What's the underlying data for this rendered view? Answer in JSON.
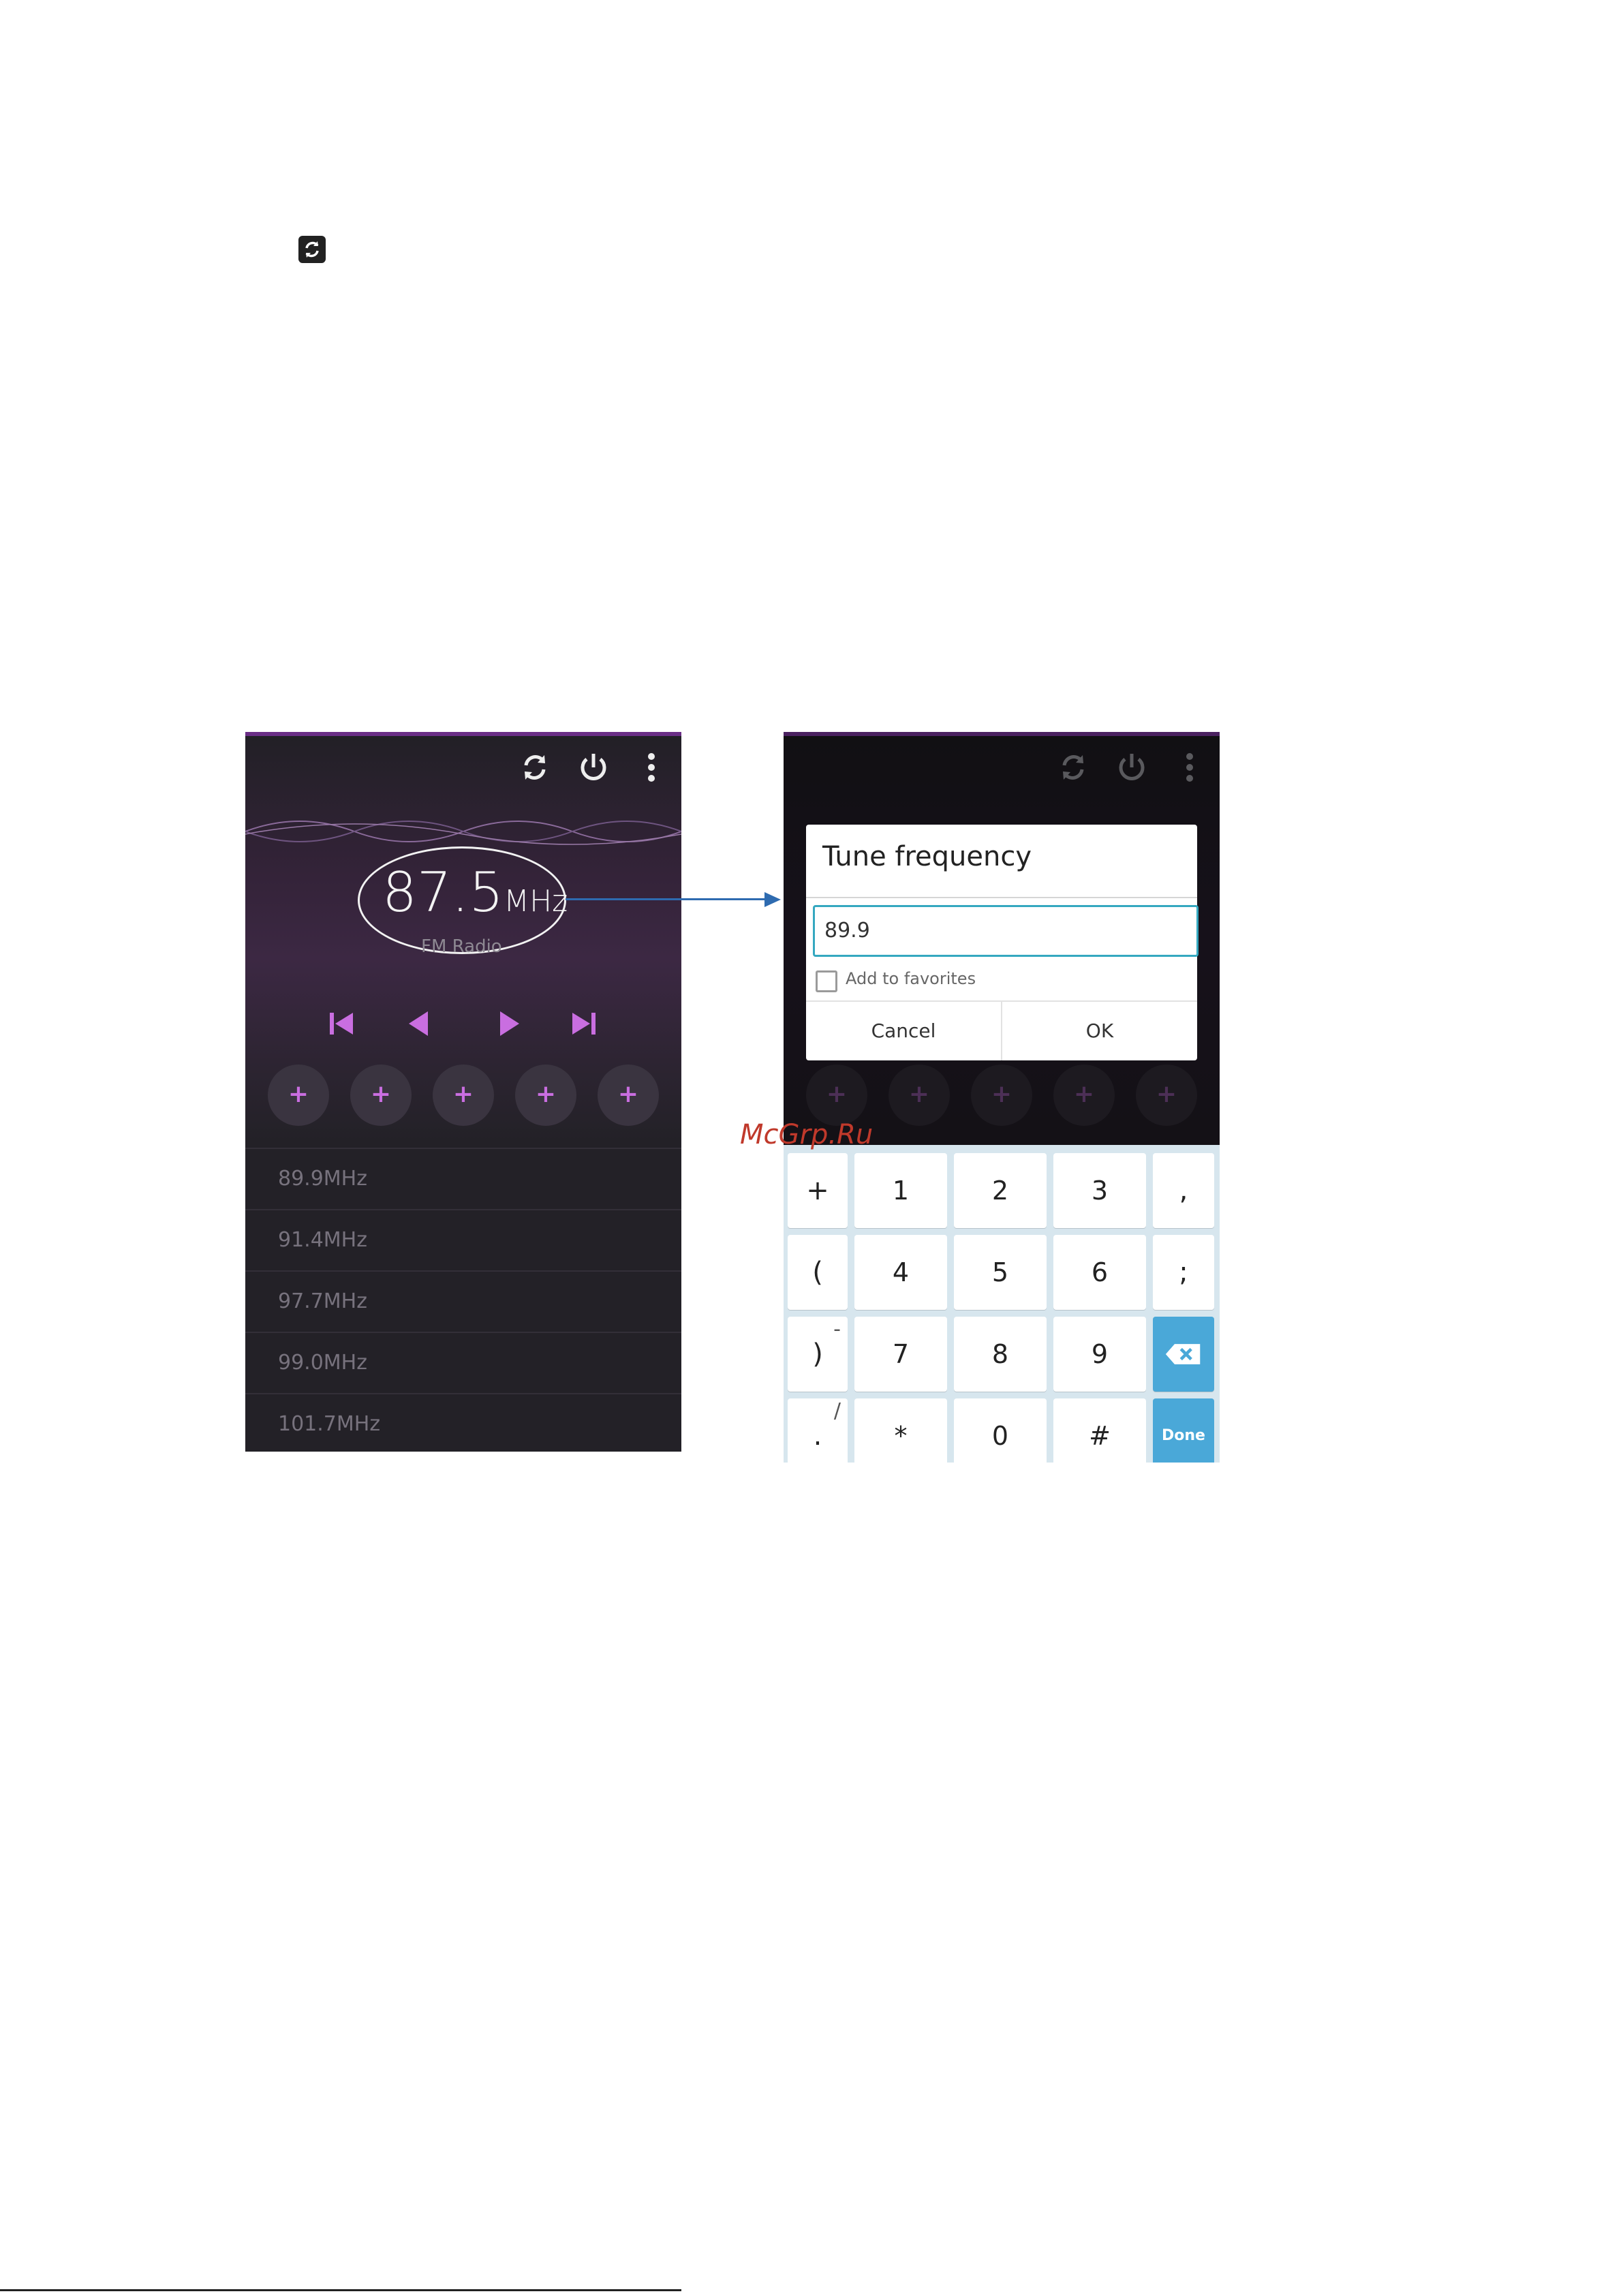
{
  "left_screen": {
    "frequency": "87.5",
    "frequency_unit": "MHz",
    "subtitle": "FM Radio",
    "favorite_buttons": [
      "+",
      "+",
      "+",
      "+",
      "+"
    ],
    "stations": [
      "89.9MHz",
      "91.4MHz",
      "97.7MHz",
      "99.0MHz",
      "101.7MHz"
    ]
  },
  "right_screen": {
    "dialog": {
      "title": "Tune frequency",
      "input_value": "89.9",
      "checkbox_label": "Add to favorites",
      "cancel_label": "Cancel",
      "ok_label": "OK"
    },
    "favorite_buttons": [
      "+",
      "+",
      "+",
      "+",
      "+"
    ],
    "keyboard": {
      "row1": [
        "+",
        "1",
        "2",
        "3",
        ","
      ],
      "row2": [
        "(",
        "4",
        "5",
        "6",
        ";"
      ],
      "row3": [
        ")",
        "7",
        "8",
        "9"
      ],
      "row3_sup": "-",
      "row4": [
        ".",
        "*",
        "0",
        "#"
      ],
      "row4_sup": "/",
      "done_label": "Done"
    }
  },
  "watermark": "McGrp.Ru",
  "colors": {
    "accent_purple": "#c96ee0",
    "arrow_blue": "#2e6bb0",
    "key_blue": "#4aa8d8",
    "input_border": "#35a8c0"
  },
  "icons": [
    "refresh-icon",
    "power-icon",
    "more-vert-icon",
    "skip-previous-icon",
    "previous-icon",
    "play-icon",
    "skip-next-icon",
    "backspace-icon"
  ]
}
